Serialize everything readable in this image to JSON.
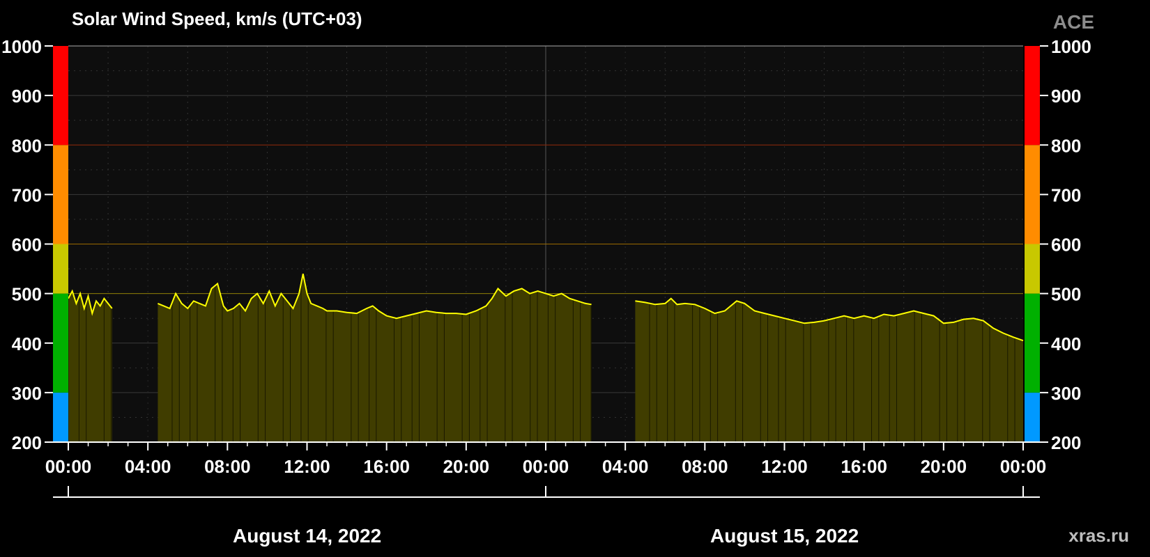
{
  "header": {
    "title": "Solar Wind Speed, km/s (UTC+03)",
    "source": "ACE",
    "site": "xras.ru"
  },
  "colors": {
    "background": "#000000",
    "plot_bg": "#0e0e0e",
    "line": "#ffff00",
    "fill": "#403d00",
    "scale_blue": "#0099ff",
    "scale_green": "#00b000",
    "scale_yellow": "#c8c800",
    "scale_orange": "#ff8c00",
    "scale_red": "#ff0000"
  },
  "chart_data": {
    "type": "area",
    "title": "Solar Wind Speed, km/s (UTC+03)",
    "ylabel": "km/s",
    "ylim": [
      200,
      1000
    ],
    "yticks": [
      200,
      300,
      400,
      500,
      600,
      700,
      800,
      900,
      1000
    ],
    "x_unit": "hours from August 14, 2022 00:00",
    "xlim": [
      0,
      48
    ],
    "xtick_hours": [
      0,
      4,
      8,
      12,
      16,
      20,
      24,
      28,
      32,
      36,
      40,
      44,
      48
    ],
    "xtick_labels": [
      "00:00",
      "04:00",
      "08:00",
      "12:00",
      "16:00",
      "20:00",
      "00:00",
      "04:00",
      "08:00",
      "12:00",
      "16:00",
      "20:00",
      "00:00"
    ],
    "date_labels": [
      {
        "label": "August 14, 2022",
        "start_hour": 0,
        "end_hour": 24
      },
      {
        "label": "August 15, 2022",
        "start_hour": 24,
        "end_hour": 48
      }
    ],
    "threshold_lines": [
      500,
      600,
      800
    ],
    "color_scale": [
      {
        "from": 200,
        "to": 300,
        "color": "#0099ff"
      },
      {
        "from": 300,
        "to": 500,
        "color": "#00b000"
      },
      {
        "from": 500,
        "to": 600,
        "color": "#c8c800"
      },
      {
        "from": 600,
        "to": 800,
        "color": "#ff8c00"
      },
      {
        "from": 800,
        "to": 1000,
        "color": "#ff0000"
      }
    ],
    "gaps": [
      [
        2.25,
        4.5
      ],
      [
        26.3,
        28.5
      ]
    ],
    "series": [
      {
        "points": [
          [
            0.0,
            490
          ],
          [
            0.2,
            505
          ],
          [
            0.4,
            480
          ],
          [
            0.6,
            500
          ],
          [
            0.8,
            470
          ],
          [
            1.0,
            495
          ],
          [
            1.2,
            460
          ],
          [
            1.4,
            485
          ],
          [
            1.6,
            475
          ],
          [
            1.8,
            490
          ],
          [
            2.0,
            480
          ],
          [
            2.2,
            470
          ],
          [
            4.5,
            480
          ],
          [
            4.8,
            475
          ],
          [
            5.1,
            470
          ],
          [
            5.4,
            500
          ],
          [
            5.7,
            480
          ],
          [
            6.0,
            470
          ],
          [
            6.3,
            485
          ],
          [
            6.6,
            480
          ],
          [
            6.9,
            475
          ],
          [
            7.2,
            510
          ],
          [
            7.5,
            520
          ],
          [
            7.8,
            475
          ],
          [
            8.0,
            465
          ],
          [
            8.3,
            470
          ],
          [
            8.6,
            480
          ],
          [
            8.9,
            465
          ],
          [
            9.2,
            490
          ],
          [
            9.5,
            500
          ],
          [
            9.8,
            480
          ],
          [
            10.1,
            505
          ],
          [
            10.4,
            475
          ],
          [
            10.7,
            500
          ],
          [
            11.0,
            485
          ],
          [
            11.3,
            470
          ],
          [
            11.6,
            500
          ],
          [
            11.8,
            540
          ],
          [
            12.0,
            500
          ],
          [
            12.2,
            480
          ],
          [
            12.5,
            475
          ],
          [
            12.8,
            470
          ],
          [
            13.0,
            465
          ],
          [
            13.5,
            465
          ],
          [
            14.0,
            462
          ],
          [
            14.5,
            460
          ],
          [
            15.0,
            470
          ],
          [
            15.3,
            475
          ],
          [
            15.6,
            465
          ],
          [
            16.0,
            455
          ],
          [
            16.5,
            450
          ],
          [
            17.0,
            455
          ],
          [
            17.5,
            460
          ],
          [
            18.0,
            465
          ],
          [
            18.5,
            462
          ],
          [
            19.0,
            460
          ],
          [
            19.5,
            460
          ],
          [
            20.0,
            458
          ],
          [
            20.5,
            465
          ],
          [
            21.0,
            475
          ],
          [
            21.3,
            490
          ],
          [
            21.6,
            510
          ],
          [
            22.0,
            495
          ],
          [
            22.4,
            505
          ],
          [
            22.8,
            510
          ],
          [
            23.2,
            500
          ],
          [
            23.6,
            505
          ],
          [
            24.0,
            500
          ],
          [
            24.4,
            495
          ],
          [
            24.8,
            500
          ],
          [
            25.2,
            490
          ],
          [
            25.6,
            485
          ],
          [
            26.0,
            480
          ],
          [
            26.3,
            478
          ],
          [
            28.5,
            485
          ],
          [
            29.0,
            482
          ],
          [
            29.5,
            478
          ],
          [
            30.0,
            480
          ],
          [
            30.3,
            490
          ],
          [
            30.6,
            478
          ],
          [
            31.0,
            480
          ],
          [
            31.5,
            478
          ],
          [
            32.0,
            470
          ],
          [
            32.5,
            460
          ],
          [
            33.0,
            465
          ],
          [
            33.3,
            475
          ],
          [
            33.6,
            485
          ],
          [
            34.0,
            480
          ],
          [
            34.5,
            465
          ],
          [
            35.0,
            460
          ],
          [
            35.5,
            455
          ],
          [
            36.0,
            450
          ],
          [
            36.5,
            445
          ],
          [
            37.0,
            440
          ],
          [
            37.5,
            442
          ],
          [
            38.0,
            445
          ],
          [
            38.5,
            450
          ],
          [
            39.0,
            455
          ],
          [
            39.5,
            450
          ],
          [
            40.0,
            455
          ],
          [
            40.5,
            450
          ],
          [
            41.0,
            458
          ],
          [
            41.5,
            455
          ],
          [
            42.0,
            460
          ],
          [
            42.5,
            465
          ],
          [
            43.0,
            460
          ],
          [
            43.5,
            455
          ],
          [
            44.0,
            440
          ],
          [
            44.5,
            442
          ],
          [
            45.0,
            448
          ],
          [
            45.5,
            450
          ],
          [
            46.0,
            445
          ],
          [
            46.5,
            430
          ],
          [
            47.0,
            420
          ],
          [
            47.5,
            412
          ],
          [
            48.0,
            405
          ]
        ]
      }
    ]
  }
}
